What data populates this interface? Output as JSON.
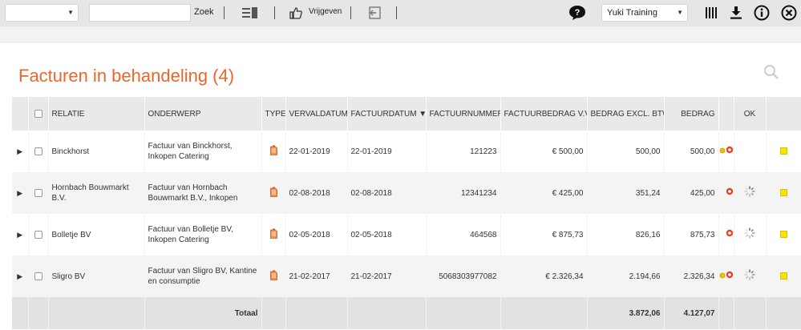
{
  "toolbar": {
    "first_select_value": "",
    "search_value": "",
    "search_button": "Zoek",
    "approve_label": "Vrijgeven",
    "domain_select_value": "Yuki Training"
  },
  "page": {
    "title": "Facturen in behandeling (4)"
  },
  "table": {
    "headers": {
      "relatie": "RELATIE",
      "onderwerp": "ONDERWERP",
      "type": "TYPE",
      "vervaldatum": "VERVALDATUM",
      "factuurdatum": "FACTUURDATUM ▼",
      "factuurnummer": "FACTUURNUMMER",
      "factuurbedrag": "FACTUURBEDRAG V.V.",
      "excl_btw": "BEDRAG EXCL. BTW",
      "bedrag": "BEDRAG",
      "ok": "OK"
    },
    "rows": [
      {
        "relatie": "Binckhorst",
        "onderwerp": "Factuur van Binckhorst, Inkopen Catering",
        "vervaldatum": "22-01-2019",
        "factuurdatum": "22-01-2019",
        "factuurnummer": "121223",
        "factuurbedrag": "€ 500,00",
        "excl_btw": "500,00",
        "bedrag": "500,00"
      },
      {
        "relatie": "Hornbach Bouwmarkt B.V.",
        "onderwerp": "Factuur van Hornbach Bouwmarkt B.V., Inkopen",
        "vervaldatum": "02-08-2018",
        "factuurdatum": "02-08-2018",
        "factuurnummer": "12341234",
        "factuurbedrag": "€ 425,00",
        "excl_btw": "351,24",
        "bedrag": "425,00"
      },
      {
        "relatie": "Bolletje BV",
        "onderwerp": "Factuur van Bolletje BV, Inkopen Catering",
        "vervaldatum": "02-05-2018",
        "factuurdatum": "02-05-2018",
        "factuurnummer": "464568",
        "factuurbedrag": "€ 875,73",
        "excl_btw": "826,16",
        "bedrag": "875,73"
      },
      {
        "relatie": "Sligro BV",
        "onderwerp": "Factuur van Sligro BV, Kantine en consumptie",
        "vervaldatum": "21-02-2017",
        "factuurdatum": "21-02-2017",
        "factuurnummer": "5068303977082",
        "factuurbedrag": "€ 2.326,34",
        "excl_btw": "2.194,66",
        "bedrag": "2.326,34"
      }
    ],
    "total": {
      "label": "Totaal",
      "excl_btw": "3.872,06",
      "bedrag": "4.127,07"
    }
  },
  "colors": {
    "title": "#e8672c",
    "toolbar_bg": "#e6e6e6",
    "status_red": "#e8402a",
    "status_yellow": "#f7e400"
  }
}
